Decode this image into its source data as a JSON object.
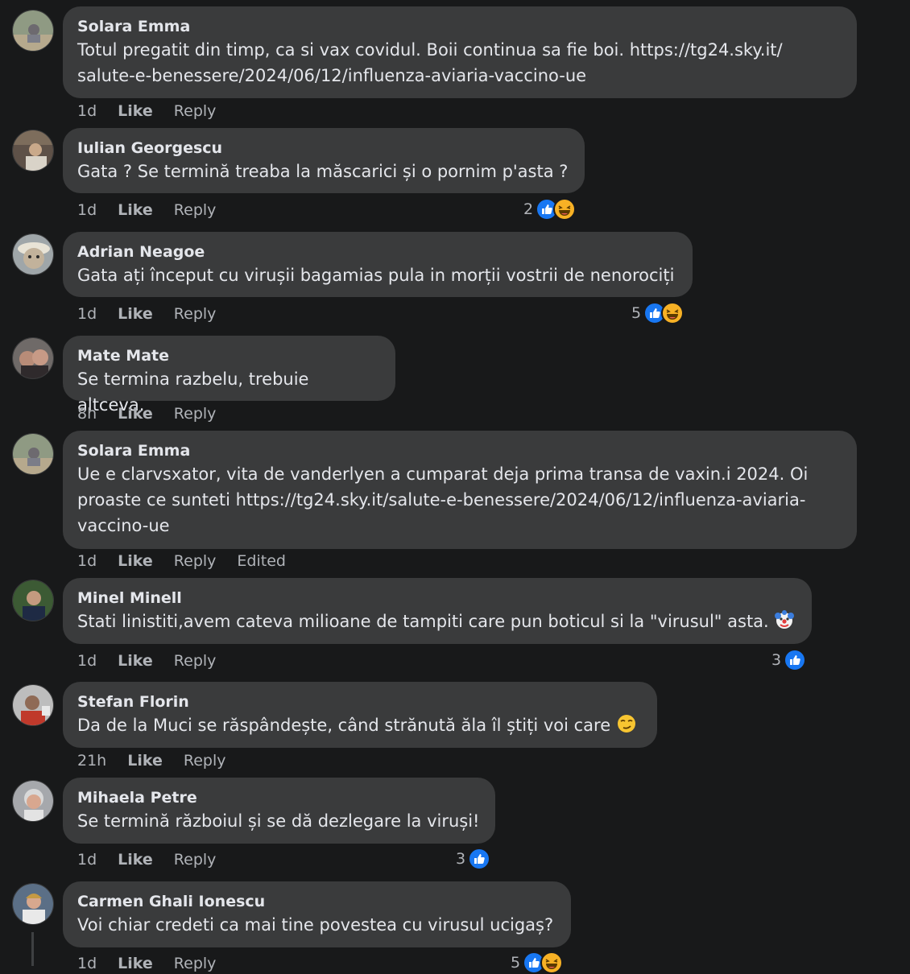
{
  "comments": [
    {
      "author": "Solara Emma",
      "text": "Totul pregatit din timp, ca si vax covidul. Boii continua sa fie boi. https://tg24.sky.it/\nsalute-e-benessere/2024/06/12/influenza-aviaria-vaccino-ue",
      "time": "1d",
      "like": "Like",
      "reply": "Reply"
    },
    {
      "author": "Iulian Georgescu",
      "text": "Gata ? Se termină treaba la măscarici și o pornim p'asta ?",
      "time": "1d",
      "like": "Like",
      "reply": "Reply",
      "reaction_count": "2",
      "reactions": [
        "like-icon",
        "haha-icon"
      ]
    },
    {
      "author": "Adrian Neagoe",
      "text": "Gata ați început cu virușii bagamias pula in morții vostrii de nenorociți",
      "time": "1d",
      "like": "Like",
      "reply": "Reply",
      "reaction_count": "5",
      "reactions": [
        "like-icon",
        "haha-icon"
      ]
    },
    {
      "author": "Mate Mate",
      "text": "Se termina razbelu, trebuie altceva.",
      "time": "8h",
      "like": "Like",
      "reply": "Reply"
    },
    {
      "author": "Solara Emma",
      "text": "Ue e clarvsxator, vita de vanderlyen a cumparat deja prima transa de vaxin.i 2024. Oi\nproaste ce sunteti https://tg24.sky.it/salute-e-benessere/2024/06/12/influenza-aviaria-\nvaccino-ue",
      "time": "1d",
      "like": "Like",
      "reply": "Reply",
      "edited": "Edited"
    },
    {
      "author": "Minel Minell",
      "text": "Stati linistiti,avem cateva milioane de tampiti care pun boticul si la \"virusul\" asta.",
      "emoji": "clown-face-emoji",
      "time": "1d",
      "like": "Like",
      "reply": "Reply",
      "reaction_count": "3",
      "reactions": [
        "like-icon"
      ]
    },
    {
      "author": "Stefan Florin",
      "text": "Da de la Muci se răspândește, când strănută ăla îl știți voi care",
      "emoji": "smirk-face-emoji",
      "time": "21h",
      "like": "Like",
      "reply": "Reply"
    },
    {
      "author": "Mihaela Petre",
      "text": "Se termină războiul și se dă dezlegare la viruși!",
      "time": "1d",
      "like": "Like",
      "reply": "Reply",
      "reaction_count": "3",
      "reactions": [
        "like-icon"
      ]
    },
    {
      "author": "Carmen Ghali Ionescu",
      "text": "Voi chiar credeti ca mai tine povestea cu virusul ucigaș?",
      "time": "1d",
      "like": "Like",
      "reply": "Reply",
      "reaction_count": "5",
      "reactions": [
        "like-icon",
        "haha-icon"
      ]
    }
  ],
  "colors": {
    "background": "#18191a",
    "bubble": "#3a3b3c",
    "primary_text": "#e4e6eb",
    "secondary_text": "#b0b3b8",
    "like_blue": "#1877f2",
    "haha_yellow": "#f7b125"
  }
}
